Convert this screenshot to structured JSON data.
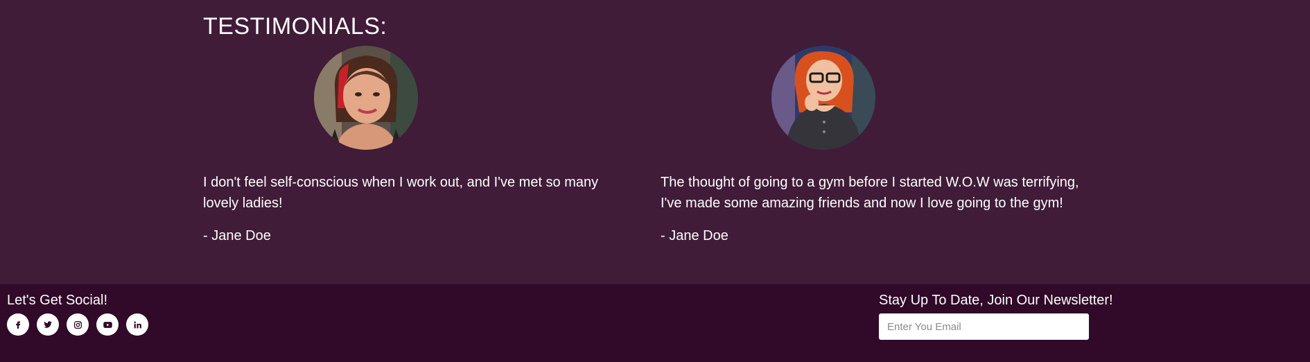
{
  "testimonials": {
    "title": "TESTIMONIALS:",
    "items": [
      {
        "quote": "I don't feel self-conscious when I work out, and I've met so many lovely ladies!",
        "author": "- Jane Doe",
        "avatar": "avatar-photo-woman-brunette"
      },
      {
        "quote": "The thought of going to a gym before I started W.O.W was terrifying, I've made some amazing friends and now I love going to the gym!",
        "author": "- Jane Doe",
        "avatar": "avatar-photo-woman-redhead-glasses"
      }
    ]
  },
  "footer": {
    "social_title": "Let's Get Social!",
    "social_icons": [
      "facebook-icon",
      "twitter-icon",
      "instagram-icon",
      "youtube-icon",
      "linkedin-icon"
    ],
    "newsletter_title": "Stay Up To Date, Join Our Newsletter!",
    "email_placeholder": "Enter You Email"
  },
  "colors": {
    "section_bg": "#401c39",
    "footer_bg": "#300a28",
    "text": "#ffffff",
    "icon_fg": "#300a28"
  }
}
